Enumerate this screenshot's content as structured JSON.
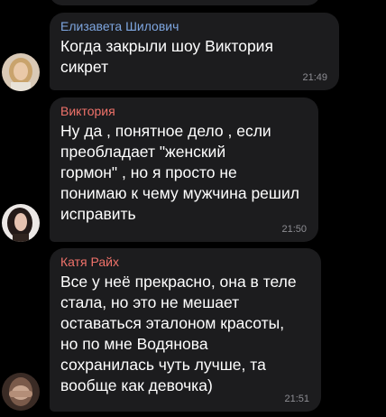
{
  "messages": [
    {
      "sender": "Елизавета Шилович",
      "sender_color": "#7ea6e0",
      "text": "Когда закрыли шоу Виктория\nсикрет",
      "time": "21:49",
      "avatar": "avatar-photo-blonde-woman"
    },
    {
      "sender": "Виктория",
      "sender_color": "#f0726a",
      "text": "Ну да , понятное дело , если\nпреобладает \"женский\nгормон\" , но я просто не\nпонимаю к чему мужчина решил\nисправить",
      "time": "21:50",
      "avatar": "avatar-photo-dark-haired-woman"
    },
    {
      "sender": "Катя Райх",
      "sender_color": "#f0726a",
      "text": "Все у неё прекрасно, она в теле\nстала, но это не мешает\nоставаться эталоном красоты,\nно по мне Водянова\nсохранилась чуть лучше, та\nвообще как девочка)",
      "time": "21:51",
      "avatar": "avatar-photo-woman-covering-face"
    }
  ]
}
